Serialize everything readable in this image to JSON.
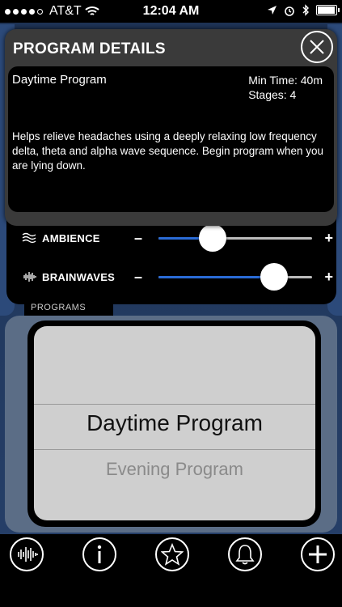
{
  "status_bar": {
    "carrier": "AT&T",
    "time": "12:04 AM"
  },
  "modal": {
    "title": "PROGRAM DETAILS",
    "program_name": "Daytime Program",
    "min_time": "Min Time: 40m",
    "stages": "Stages: 4",
    "description": "Helps relieve headaches using a deeply relaxing low frequency delta, theta and alpha wave sequence.  Begin program when you are lying down."
  },
  "sliders": [
    {
      "label": "AMBIENCE",
      "minus": "–",
      "plus": "+",
      "value": 0.35
    },
    {
      "label": "BRAINWAVES",
      "minus": "–",
      "plus": "+",
      "value": 0.75
    }
  ],
  "programs": {
    "label": "PROGRAMS",
    "selected": "Daytime Program",
    "next": "Evening Program"
  },
  "toolbar": {
    "buttons": [
      "brainwave-icon",
      "info-icon",
      "star-icon",
      "bell-icon",
      "plus-icon"
    ]
  },
  "colors": {
    "accent": "#2a6bd6",
    "background": "#1e3355"
  }
}
